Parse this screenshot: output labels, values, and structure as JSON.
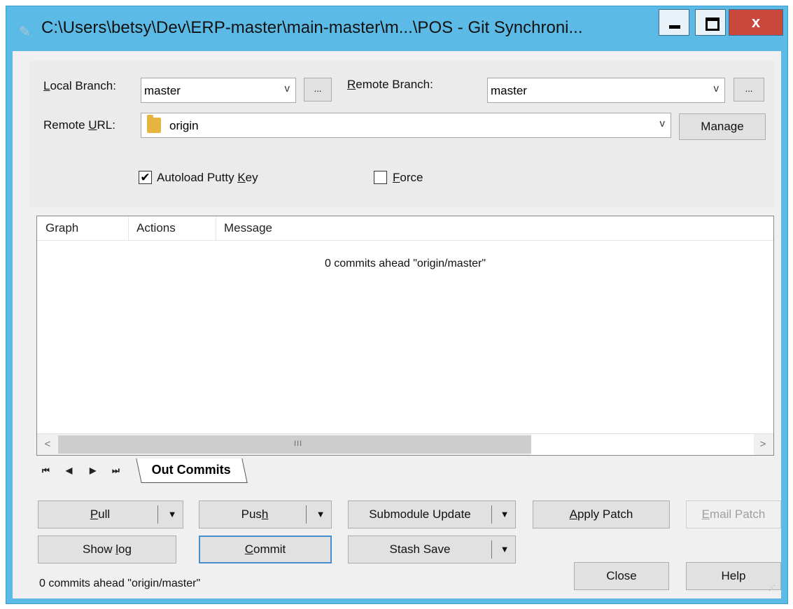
{
  "window": {
    "title": "C:\\Users\\betsy\\Dev\\ERP-master\\main-master\\m...\\POS - Git Synchroni...",
    "close_glyph": "x"
  },
  "colors": {
    "titlebar": "#5bbbe6",
    "client": "#f0f0f0",
    "close_button": "#c9473b"
  },
  "branch": {
    "local_label_pre": "",
    "local_label_mn": "L",
    "local_label_post": "ocal Branch:",
    "local_value": "master",
    "remote_label_pre": "",
    "remote_label_mn": "R",
    "remote_label_post": "emote Branch:",
    "remote_value": "master",
    "browse_label": "...",
    "dropdown_glyph": "v"
  },
  "remote": {
    "url_label_pre": "Remote ",
    "url_label_mn": "U",
    "url_label_post": "RL:",
    "url_value": "origin",
    "manage_label": "Manage"
  },
  "options": {
    "autoload_pre": "Autoload Putty ",
    "autoload_mn": "K",
    "autoload_post": "ey",
    "autoload_checked": true,
    "autoload_mark": "✔",
    "force_pre": "",
    "force_mn": "F",
    "force_post": "orce",
    "force_checked": false
  },
  "commits_list": {
    "columns": [
      "Graph",
      "Actions",
      "Message"
    ],
    "message": "0 commits ahead \"origin/master\"",
    "scroll_left": "<",
    "scroll_right": ">",
    "scroll_grip": "III"
  },
  "tabs": {
    "nav": [
      "⏮",
      "◀",
      "▶",
      "⏭"
    ],
    "active": "Out Commits"
  },
  "actions": {
    "pull_pre": "",
    "pull_mn": "P",
    "pull_post": "ull",
    "push_pre": "Pus",
    "push_mn": "h",
    "push_post": "",
    "submodule": "Submodule Update",
    "apply_patch_pre": "",
    "apply_patch_mn": "A",
    "apply_patch_post": "pply Patch",
    "email_patch_pre": "",
    "email_patch_mn": "E",
    "email_patch_post": "mail Patch",
    "show_log_pre": "Show ",
    "show_log_mn": "l",
    "show_log_post": "og",
    "commit_pre": "",
    "commit_mn": "C",
    "commit_post": "ommit",
    "stash_save": "Stash Save",
    "close": "Close",
    "help": "Help",
    "dropdown_glyph": "▼"
  },
  "status": "0 commits ahead \"origin/master\""
}
